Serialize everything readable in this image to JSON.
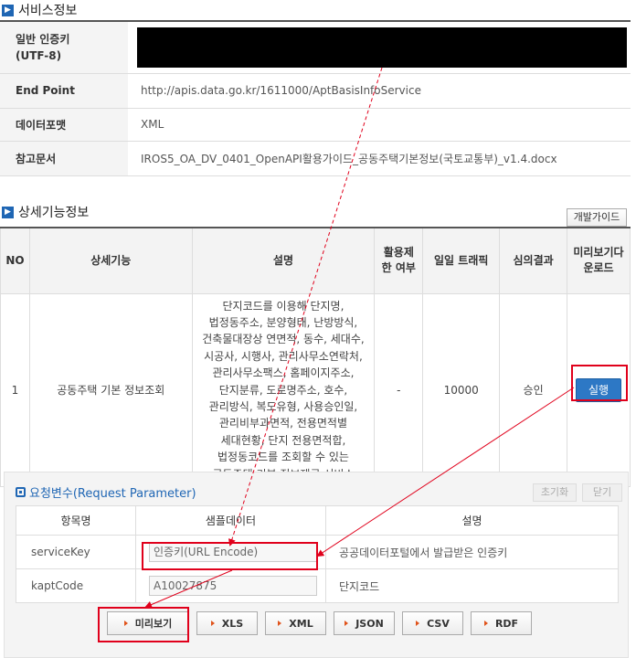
{
  "service_info": {
    "title": "서비스정보",
    "rows": [
      {
        "key": "일반 인증키\n(UTF-8)",
        "value": ""
      },
      {
        "key": "End Point",
        "value": "http://apis.data.go.kr/1611000/AptBasisInfoService"
      },
      {
        "key": "데이터포맷",
        "value": "XML"
      },
      {
        "key": "참고문서",
        "value": "IROS5_OA_DV_0401_OpenAPI활용가이드_공동주택기본정보(국토교통부)_v1.4.docx"
      }
    ]
  },
  "detail": {
    "title": "상세기능정보",
    "guide_button": "개발가이드",
    "headers": {
      "no": "NO",
      "function": "상세기능",
      "description": "설명",
      "limit": "활용제한 여부",
      "traffic": "일일 트래픽",
      "review": "심의결과",
      "preview": "미리보기다운로드"
    },
    "row": {
      "no": "1",
      "function": "공동주택 기본 정보조회",
      "description": "단지코드를 이용해 단지명, 법정동주소, 분양형태, 난방방식, 건축물대장상 연면적, 동수, 세대수, 시공사, 시행사, 관리사무소연락처, 관리사무소팩스, 홈페이지주소, 단지분류, 도로명주소, 호수, 관리방식, 복도유형, 사용승인일, 관리비부과면적, 전용면적별 세대현황, 단지 전용면적합, 법정동코드를 조회할 수 있는 공동주택 기본 정보제공 서비스",
      "limit": "-",
      "traffic": "10000",
      "review": "승인",
      "run_button": "실행"
    }
  },
  "request": {
    "title": "요청변수(Request Parameter)",
    "reset_button": "초기화",
    "close_button": "닫기",
    "headers": {
      "name": "항목명",
      "sample": "샘플데이터",
      "desc": "설명"
    },
    "params": [
      {
        "name": "serviceKey",
        "sample": "인증키(URL Encode)",
        "desc": "공공데이터포털에서 발급받은 인증키"
      },
      {
        "name": "kaptCode",
        "sample": "A10027875",
        "desc": "단지코드"
      }
    ],
    "buttons": [
      "미리보기",
      "XLS",
      "XML",
      "JSON",
      "CSV",
      "RDF"
    ]
  },
  "colors": {
    "accent": "#1f66b4",
    "highlight": "#e0001b",
    "run_button": "#2d78c5"
  }
}
